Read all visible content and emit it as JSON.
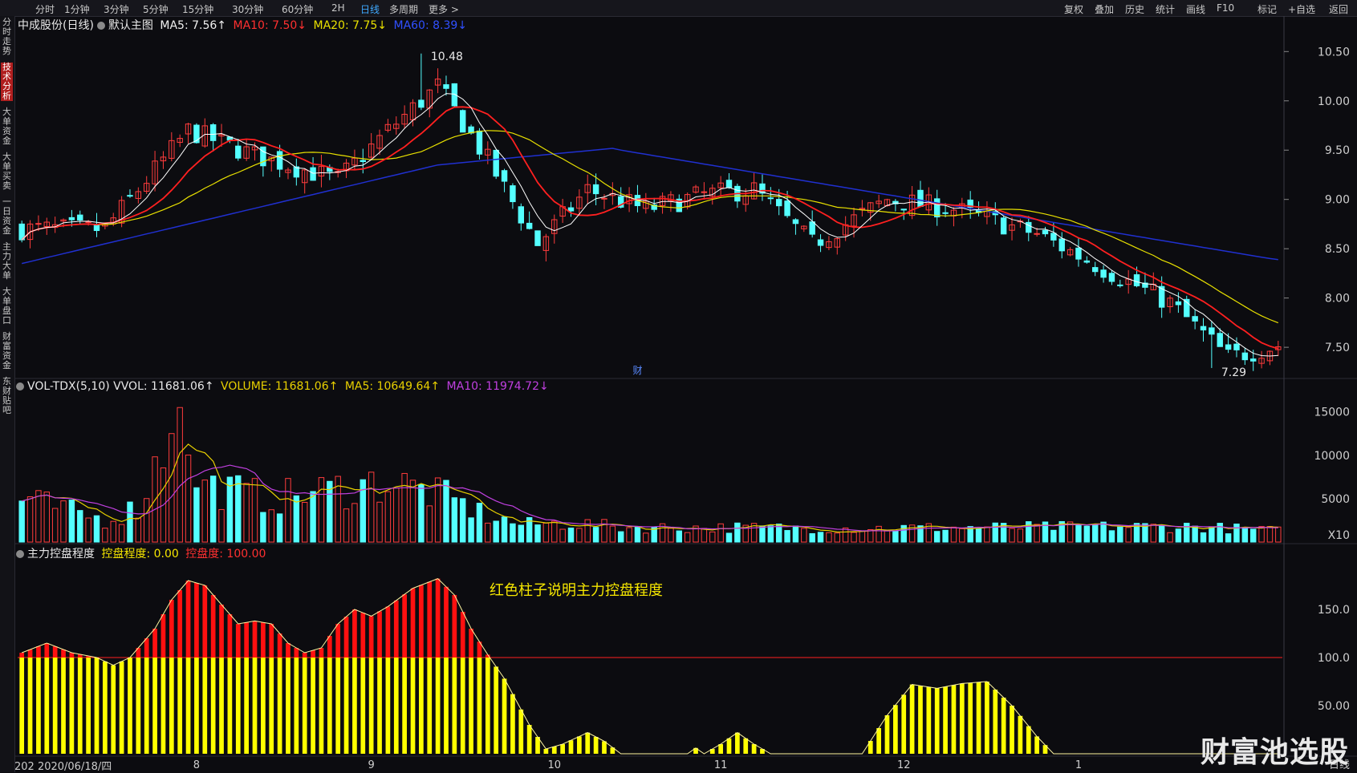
{
  "topbar": {
    "left": [
      "分时",
      "1分钟",
      "3分钟",
      "5分钟",
      "15分钟",
      "30分钟",
      "60分钟",
      "2H",
      "日线",
      "多周期",
      "更多 >"
    ],
    "active": "日线",
    "right": [
      "复权",
      "叠加",
      "历史",
      "统计",
      "画线",
      "F10",
      "标记",
      "+自选",
      "返回"
    ]
  },
  "sidebar": [
    "分时走势",
    "技术分析",
    "大单资金",
    "大单买卖",
    "一日资金",
    "主力大单",
    "大单盘口",
    "财富资金",
    "东财贴吧"
  ],
  "main_header": {
    "title": "中成股份(日线)",
    "template": "默认主图",
    "ma5": "MA5: 7.56↑",
    "ma10": "MA10: 7.50↓",
    "ma20": "MA20: 7.75↓",
    "ma60": "MA60: 8.39↓"
  },
  "vol_header": {
    "title": "VOL-TDX(5,10) VVOL: 11681.06↑",
    "volume": "VOLUME: 11681.06↑",
    "ma5": "MA5: 10649.64↑",
    "ma10": "MA10: 11974.72↓"
  },
  "ctrl_header": {
    "title": "主力控盘程度",
    "kpcd": "控盘程度: 0.00",
    "kpd": "控盘度: 100.00"
  },
  "annotation": "红色柱子说明主力控盘程度",
  "footer_date": "202 2020/06/18/四",
  "period_label": "日线",
  "x10_label": "X10",
  "fin_marker": "财",
  "watermark": "财富池选股",
  "colors": {
    "up": "#ff3c3c",
    "down": "#54ffff",
    "ma5": "#ffffff",
    "ma10": "#ff2020",
    "ma20": "#e8e000",
    "ma60": "#2030d0",
    "vol_ma5": "#e8d000",
    "vol_ma10": "#c040e0",
    "ctrl_red": "#ff1010",
    "ctrl_yellow": "#ffff00",
    "bg": "#0c0c10"
  },
  "chart_data": [
    {
      "type": "candlestick",
      "title": "中成股份(日线)",
      "ylim": [
        7.2,
        10.6
      ],
      "yticks": [
        10.5,
        10.0,
        9.5,
        9.0,
        8.5,
        8.0,
        7.5
      ],
      "xtick_labels": [
        "8",
        "9",
        "10",
        "11",
        "12",
        "1"
      ],
      "high_label": "10.48",
      "low_label": "7.29",
      "last_ma": {
        "MA5": 7.56,
        "MA10": 7.5,
        "MA20": 7.75,
        "MA60": 8.39
      },
      "close_anchors": [
        [
          0,
          8.7
        ],
        [
          10,
          8.7
        ],
        [
          20,
          9.7
        ],
        [
          28,
          9.45
        ],
        [
          38,
          9.2
        ],
        [
          44,
          9.7
        ],
        [
          50,
          10.15
        ],
        [
          56,
          9.4
        ],
        [
          62,
          8.55
        ],
        [
          68,
          9.1
        ],
        [
          75,
          8.9
        ],
        [
          82,
          9.05
        ],
        [
          88,
          9.1
        ],
        [
          95,
          8.55
        ],
        [
          104,
          9.0
        ],
        [
          112,
          8.9
        ],
        [
          122,
          8.65
        ],
        [
          130,
          8.3
        ],
        [
          138,
          7.95
        ],
        [
          145,
          7.4
        ],
        [
          151,
          7.52
        ]
      ],
      "n_bars": 152
    },
    {
      "type": "bar",
      "title": "VOL-TDX(5,10)",
      "ylim": [
        0,
        17000
      ],
      "yticks": [
        15000,
        10000,
        5000
      ],
      "unit_label": "X10",
      "vol_anchors": [
        [
          0,
          5000
        ],
        [
          10,
          2500
        ],
        [
          14,
          4000
        ],
        [
          17,
          11000
        ],
        [
          22,
          6500
        ],
        [
          30,
          5000
        ],
        [
          44,
          7000
        ],
        [
          50,
          5500
        ],
        [
          56,
          3000
        ],
        [
          60,
          2000
        ],
        [
          66,
          2200
        ],
        [
          72,
          1700
        ],
        [
          100,
          1600
        ],
        [
          120,
          1700
        ],
        [
          140,
          1800
        ],
        [
          151,
          1300
        ]
      ],
      "last": {
        "VOLUME": 11681.06,
        "MA5": 10649.64,
        "MA10": 11974.72
      }
    },
    {
      "type": "bar",
      "title": "主力控盘程度",
      "ylim": [
        0,
        200
      ],
      "yticks": [
        150.0,
        100.0,
        50.0
      ],
      "threshold": 100,
      "ctrl_anchors": [
        [
          0,
          105
        ],
        [
          3,
          115
        ],
        [
          6,
          105
        ],
        [
          9,
          100
        ],
        [
          11,
          92
        ],
        [
          13,
          100
        ],
        [
          16,
          130
        ],
        [
          18,
          160
        ],
        [
          20,
          180
        ],
        [
          22,
          175
        ],
        [
          24,
          155
        ],
        [
          26,
          135
        ],
        [
          28,
          138
        ],
        [
          30,
          135
        ],
        [
          32,
          115
        ],
        [
          34,
          105
        ],
        [
          36,
          110
        ],
        [
          38,
          135
        ],
        [
          40,
          150
        ],
        [
          42,
          143
        ],
        [
          44,
          153
        ],
        [
          47,
          172
        ],
        [
          50,
          182
        ],
        [
          52,
          165
        ],
        [
          54,
          130
        ],
        [
          56,
          103
        ],
        [
          58,
          78
        ],
        [
          61,
          30
        ],
        [
          63,
          5
        ],
        [
          65,
          10
        ],
        [
          68,
          22
        ],
        [
          70,
          13
        ],
        [
          72,
          0
        ],
        [
          80,
          0
        ],
        [
          81,
          6
        ],
        [
          82,
          0
        ],
        [
          84,
          10
        ],
        [
          86,
          22
        ],
        [
          88,
          10
        ],
        [
          90,
          0
        ],
        [
          101,
          0
        ],
        [
          104,
          40
        ],
        [
          107,
          72
        ],
        [
          110,
          68
        ],
        [
          113,
          73
        ],
        [
          116,
          75
        ],
        [
          119,
          50
        ],
        [
          122,
          18
        ],
        [
          124,
          0
        ],
        [
          151,
          0
        ]
      ],
      "last": {
        "控盘程度": 0.0,
        "控盘度": 100.0
      }
    }
  ]
}
